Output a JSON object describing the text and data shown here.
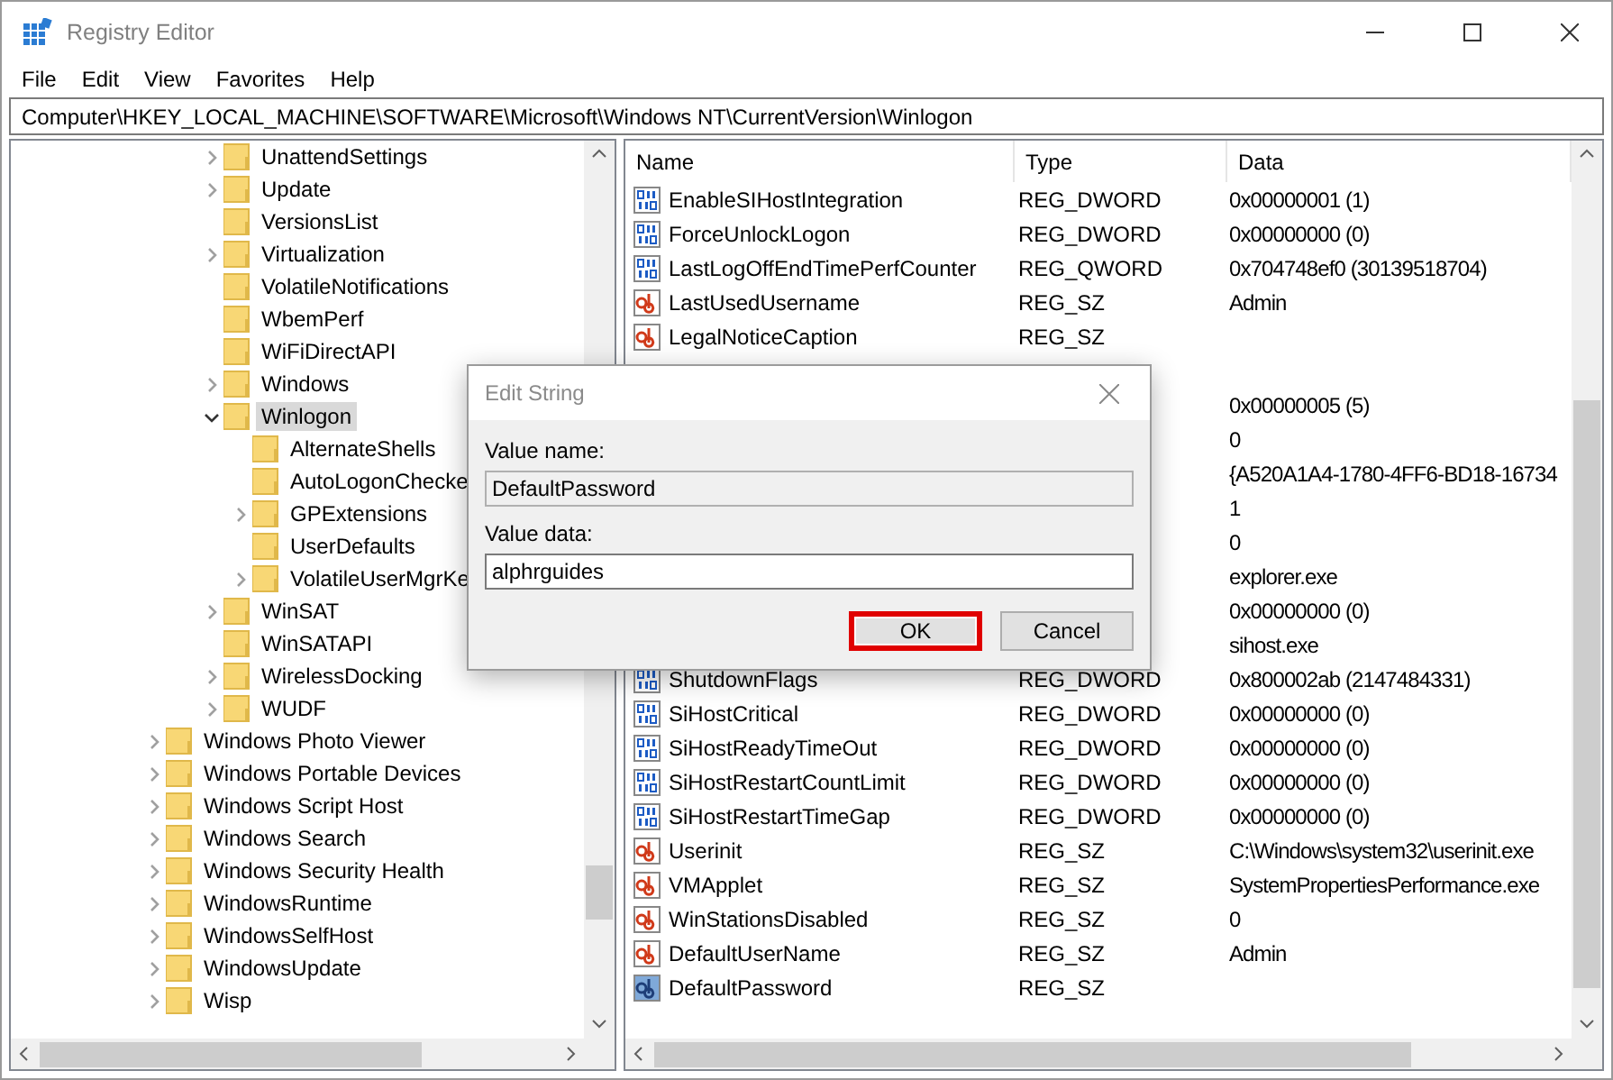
{
  "window": {
    "title": "Registry Editor"
  },
  "menu": [
    "File",
    "Edit",
    "View",
    "Favorites",
    "Help"
  ],
  "address": "Computer\\HKEY_LOCAL_MACHINE\\SOFTWARE\\Microsoft\\Windows NT\\CurrentVersion\\Winlogon",
  "tree": {
    "continued_items": [
      {
        "label": "UnattendSettings",
        "expandable": true,
        "expanded": false,
        "selected": false
      },
      {
        "label": "Update",
        "expandable": true,
        "expanded": false,
        "selected": false
      },
      {
        "label": "VersionsList",
        "expandable": false,
        "selected": false
      },
      {
        "label": "Virtualization",
        "expandable": true,
        "expanded": false,
        "selected": false
      },
      {
        "label": "VolatileNotifications",
        "expandable": false,
        "selected": false
      },
      {
        "label": "WbemPerf",
        "expandable": false,
        "selected": false
      },
      {
        "label": "WiFiDirectAPI",
        "expandable": false,
        "selected": false
      },
      {
        "label": "Windows",
        "expandable": true,
        "expanded": false,
        "selected": false
      },
      {
        "label": "Winlogon",
        "expandable": true,
        "expanded": true,
        "selected": true,
        "children": [
          {
            "label": "AlternateShells",
            "expandable": false,
            "selected": false
          },
          {
            "label": "AutoLogonChecke",
            "expandable": false,
            "selected": false
          },
          {
            "label": "GPExtensions",
            "expandable": true,
            "expanded": false,
            "selected": false
          },
          {
            "label": "UserDefaults",
            "expandable": false,
            "selected": false
          },
          {
            "label": "VolatileUserMgrKe",
            "expandable": true,
            "expanded": false,
            "selected": false
          }
        ]
      },
      {
        "label": "WinSAT",
        "expandable": true,
        "expanded": false,
        "selected": false
      },
      {
        "label": "WinSATAPI",
        "expandable": false,
        "selected": false
      },
      {
        "label": "WirelessDocking",
        "expandable": true,
        "expanded": false,
        "selected": false
      },
      {
        "label": "WUDF",
        "expandable": true,
        "expanded": false,
        "selected": false
      }
    ],
    "items": [
      {
        "label": "Windows Photo Viewer",
        "expandable": true,
        "expanded": false,
        "selected": false
      },
      {
        "label": "Windows Portable Devices",
        "expandable": true,
        "expanded": false,
        "selected": false
      },
      {
        "label": "Windows Script Host",
        "expandable": true,
        "expanded": false,
        "selected": false
      },
      {
        "label": "Windows Search",
        "expandable": true,
        "expanded": false,
        "selected": false
      },
      {
        "label": "Windows Security Health",
        "expandable": true,
        "expanded": false,
        "selected": false
      },
      {
        "label": "WindowsRuntime",
        "expandable": true,
        "expanded": false,
        "selected": false
      },
      {
        "label": "WindowsSelfHost",
        "expandable": true,
        "expanded": false,
        "selected": false
      },
      {
        "label": "WindowsUpdate",
        "expandable": true,
        "expanded": false,
        "selected": false
      },
      {
        "label": "Wisp",
        "expandable": true,
        "expanded": false,
        "selected": false
      }
    ]
  },
  "values": {
    "columns": [
      "Name",
      "Type",
      "Data"
    ],
    "rows": [
      {
        "kind": "dword",
        "name": "EnableSIHostIntegration",
        "type": "REG_DWORD",
        "data": "0x00000001 (1)",
        "selected": false
      },
      {
        "kind": "dword",
        "name": "ForceUnlockLogon",
        "type": "REG_DWORD",
        "data": "0x00000000 (0)",
        "selected": false
      },
      {
        "kind": "dword",
        "name": "LastLogOffEndTimePerfCounter",
        "type": "REG_QWORD",
        "data": "0x704748ef0 (30139518704)",
        "selected": false
      },
      {
        "kind": "sz",
        "name": "LastUsedUsername",
        "type": "REG_SZ",
        "data": "Admin",
        "selected": false
      },
      {
        "kind": "sz",
        "name": "LegalNoticeCaption",
        "type": "REG_SZ",
        "selected": false
      },
      {
        "kind": "covered"
      },
      {
        "kind": "covered",
        "data": "0x00000005 (5)"
      },
      {
        "kind": "covered",
        "data": "0"
      },
      {
        "kind": "covered",
        "data": "{A520A1A4-1780-4FF6-BD18-16734"
      },
      {
        "kind": "covered",
        "data": "1"
      },
      {
        "kind": "covered",
        "data": "0"
      },
      {
        "kind": "covered",
        "data": "explorer.exe"
      },
      {
        "kind": "covered",
        "data": "0x00000000 (0)"
      },
      {
        "kind": "covered",
        "data": "sihost.exe"
      },
      {
        "kind": "dword",
        "name": "ShutdownFlags",
        "type": "REG_DWORD",
        "data": "0x800002ab (2147484331)",
        "selected": false
      },
      {
        "kind": "dword",
        "name": "SiHostCritical",
        "type": "REG_DWORD",
        "data": "0x00000000 (0)",
        "selected": false
      },
      {
        "kind": "dword",
        "name": "SiHostReadyTimeOut",
        "type": "REG_DWORD",
        "data": "0x00000000 (0)",
        "selected": false
      },
      {
        "kind": "dword",
        "name": "SiHostRestartCountLimit",
        "type": "REG_DWORD",
        "data": "0x00000000 (0)",
        "selected": false
      },
      {
        "kind": "dword",
        "name": "SiHostRestartTimeGap",
        "type": "REG_DWORD",
        "data": "0x00000000 (0)",
        "selected": false
      },
      {
        "kind": "sz",
        "name": "Userinit",
        "type": "REG_SZ",
        "data": "C:\\Windows\\system32\\userinit.exe",
        "selected": false
      },
      {
        "kind": "sz",
        "name": "VMApplet",
        "type": "REG_SZ",
        "data": "SystemPropertiesPerformance.exe",
        "selected": false
      },
      {
        "kind": "sz",
        "name": "WinStationsDisabled",
        "type": "REG_SZ",
        "data": "0",
        "selected": false
      },
      {
        "kind": "sz",
        "name": "DefaultUserName",
        "type": "REG_SZ",
        "data": "Admin",
        "selected": false
      },
      {
        "kind": "sz",
        "name": "DefaultPassword",
        "type": "REG_SZ",
        "selected": true
      }
    ]
  },
  "dialog": {
    "title": "Edit String",
    "name_label": "Value name:",
    "name_value": "DefaultPassword",
    "data_label": "Value data:",
    "data_value": "alphrguides",
    "buttons": [
      {
        "label": "OK",
        "highlighted": true
      },
      {
        "label": "Cancel",
        "highlighted": false
      }
    ]
  }
}
